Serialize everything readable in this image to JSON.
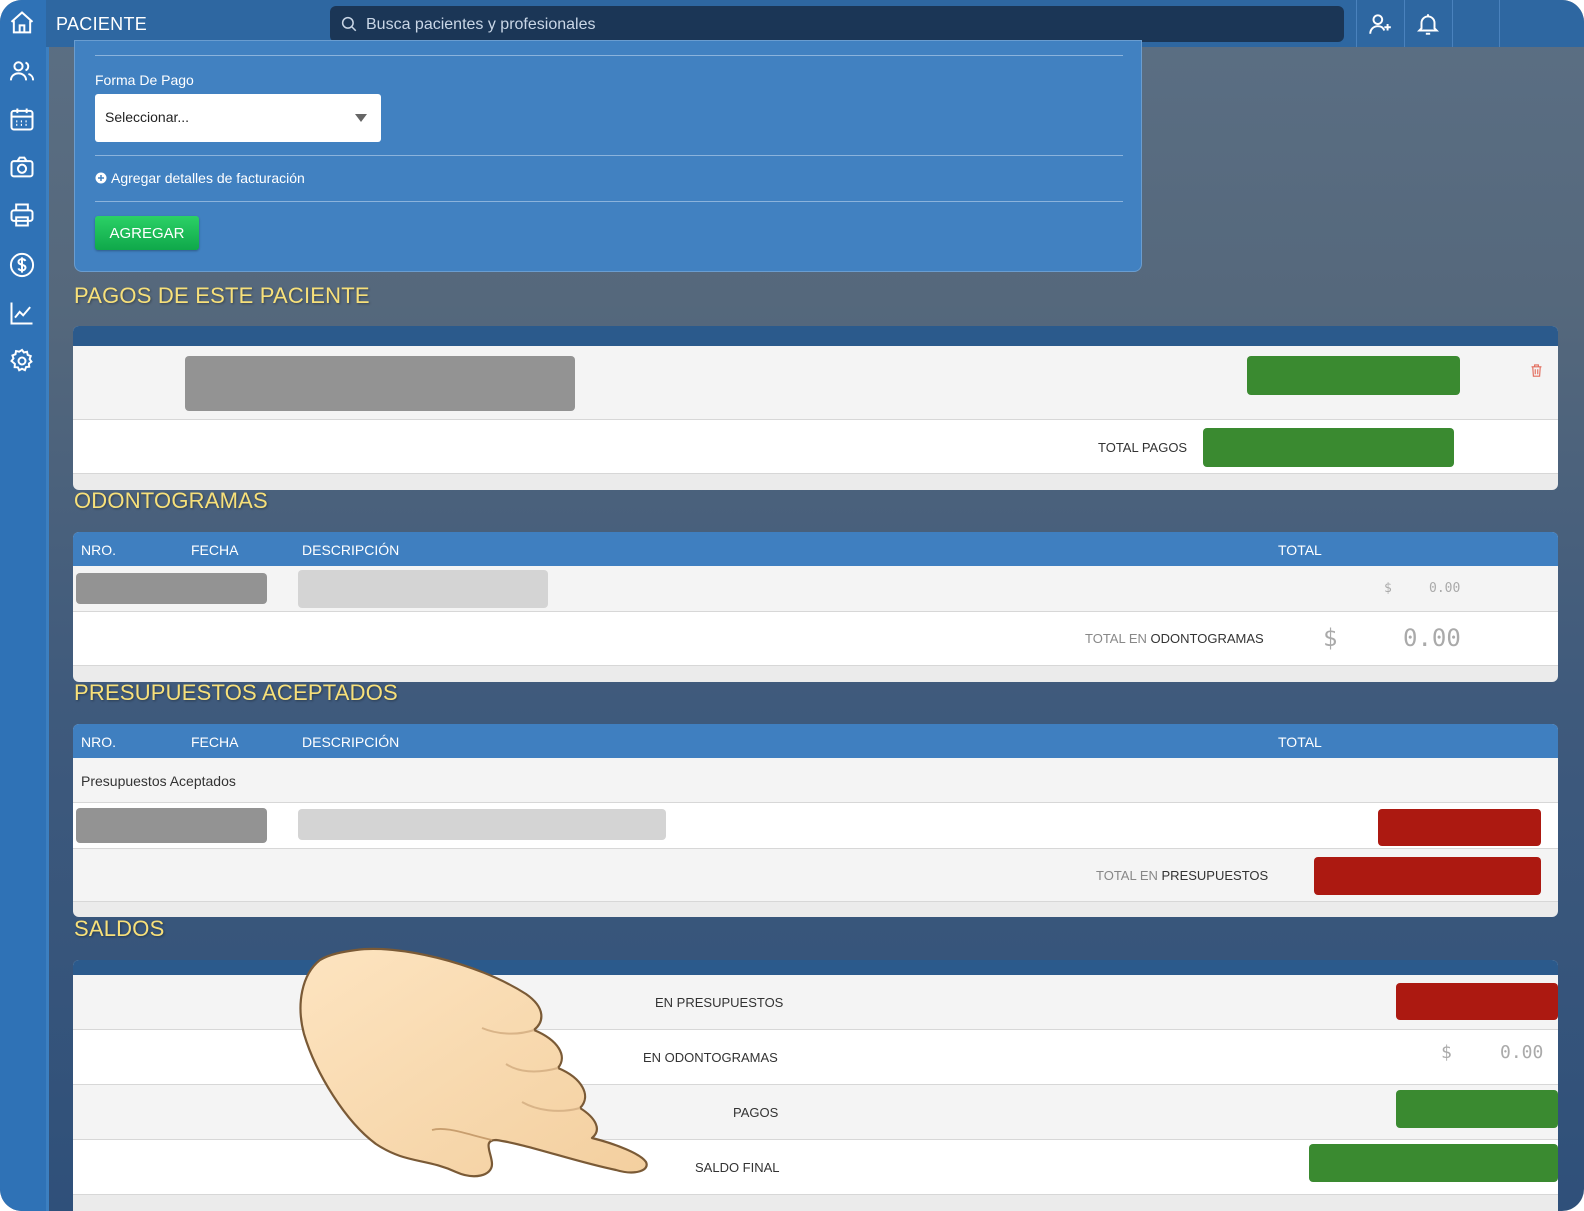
{
  "topbar": {
    "title": "PACIENTE",
    "search_placeholder": "Busca pacientes y profesionales"
  },
  "sidebar": {
    "icons": [
      "home-icon",
      "users-icon",
      "calendar-icon",
      "camera-icon",
      "printer-icon",
      "dollar-icon",
      "chart-icon",
      "gear-icon"
    ]
  },
  "form": {
    "payment_label": "Forma De Pago",
    "payment_select_value": "Seleccionar...",
    "billing_link": "Agregar detalles de facturación",
    "add_button": "AGREGAR"
  },
  "payments": {
    "title": "PAGOS DE ESTE PACIENTE",
    "total_label": "TOTAL PAGOS"
  },
  "odontograms": {
    "title": "ODONTOGRAMAS",
    "columns": [
      "NRO.",
      "FECHA",
      "DESCRIPCIÓN",
      "TOTAL"
    ],
    "row_currency": "$",
    "row_amount": "0.00",
    "total_label_prefix": "TOTAL EN",
    "total_label_suffix": "ODONTOGRAMAS",
    "total_currency": "$",
    "total_amount": "0.00"
  },
  "budgets": {
    "title": "PRESUPUESTOS ACEPTADOS",
    "columns": [
      "NRO.",
      "FECHA",
      "DESCRIPCIÓN",
      "TOTAL"
    ],
    "group_label": "Presupuestos Aceptados",
    "total_label_prefix": "TOTAL EN",
    "total_label_suffix": "PRESUPUESTOS"
  },
  "balances": {
    "title": "SALDOS",
    "rows": [
      "EN PRESUPUESTOS",
      "EN ODONTOGRAMAS",
      "PAGOS",
      "SALDO FINAL"
    ],
    "odontogram_currency": "$",
    "odontogram_amount": "0.00"
  },
  "colors": {
    "sidebar": "#2f72b6",
    "heading": "#f7e07a",
    "positive": "#3a8a30",
    "negative": "#ac1911",
    "button": "#1ec25a"
  }
}
